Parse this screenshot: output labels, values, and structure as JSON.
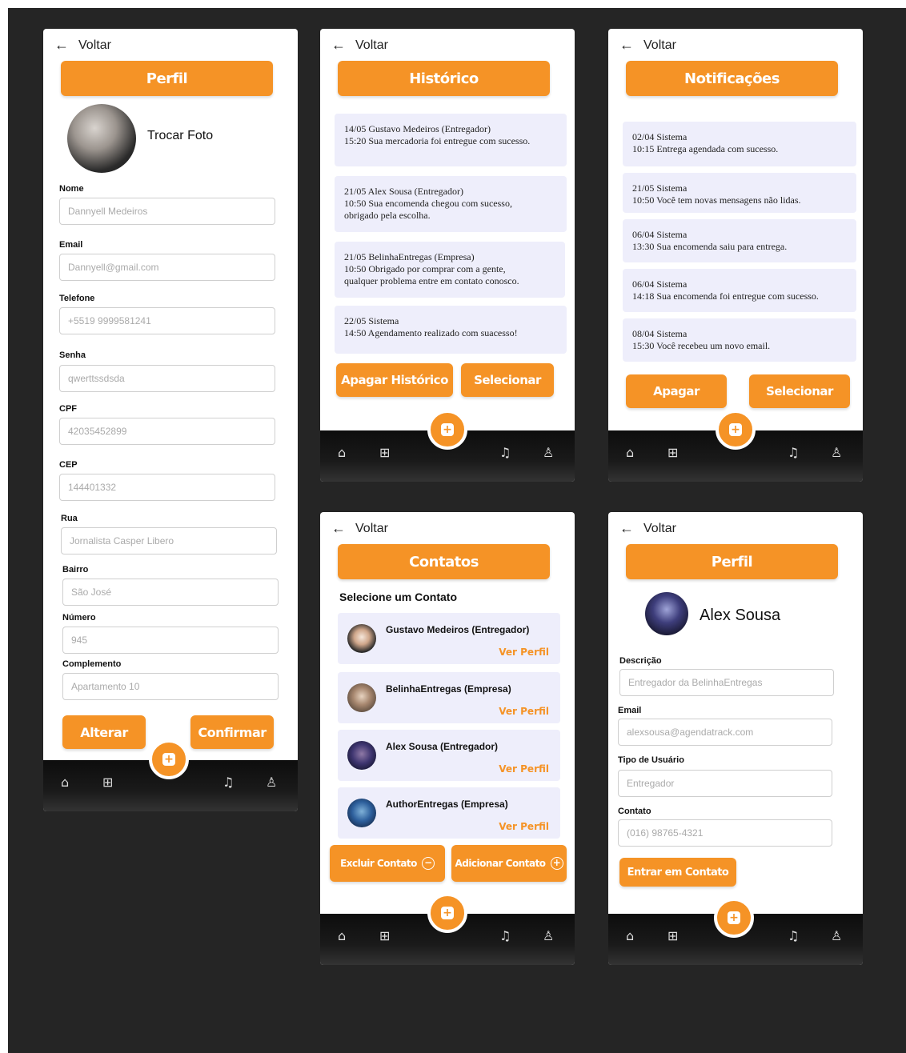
{
  "common": {
    "back_label": "Voltar",
    "nav_icons": [
      "home-icon",
      "grid-icon",
      "bell-icon",
      "user-icon"
    ]
  },
  "colors": {
    "accent": "#f59326",
    "card_bg": "#eeeefb",
    "background": "#252525"
  },
  "profile_edit": {
    "title": "Perfil",
    "change_photo": "Trocar Foto",
    "fields": [
      {
        "label": "Nome",
        "value": "Dannyell Medeiros"
      },
      {
        "label": "Email",
        "value": "Dannyell@gmail.com"
      },
      {
        "label": "Telefone",
        "value": "+5519 9999581241"
      },
      {
        "label": "Senha",
        "value": "qwerttssdsda"
      },
      {
        "label": "CPF",
        "value": "42035452899"
      },
      {
        "label": "CEP",
        "value": "144401332"
      },
      {
        "label": "Rua",
        "value": "Jornalista Casper Libero"
      },
      {
        "label": "Bairro",
        "value": "São José"
      },
      {
        "label": "Número",
        "value": "945"
      },
      {
        "label": "Complemento",
        "value": "Apartamento 10"
      }
    ],
    "alter_label": "Alterar",
    "confirm_label": "Confirmar"
  },
  "history": {
    "title": "Histórico",
    "items": [
      {
        "line1": "14/05  Gustavo Medeiros (Entregador)",
        "line2": "15:20   Sua mercadoria foi entregue com sucesso."
      },
      {
        "line1": "21/05  Alex Sousa (Entregador)",
        "line2": "10:50   Sua encomenda chegou com sucesso,",
        "line3": "obrigado pela escolha."
      },
      {
        "line1": "21/05  BelinhaEntregas (Empresa)",
        "line2": "10:50   Obrigado por comprar com a gente,",
        "line3": "qualquer problema entre em contato conosco."
      },
      {
        "line1": "22/05  Sistema",
        "line2": "14:50   Agendamento realizado com suacesso!"
      }
    ],
    "clear_label": "Apagar Histórico",
    "select_label": "Selecionar"
  },
  "notifications": {
    "title": "Notificações",
    "items": [
      {
        "line1": "02/04  Sistema",
        "line2": "10:15   Entrega agendada com sucesso."
      },
      {
        "line1": "21/05  Sistema",
        "line2": "10:50   Você tem novas mensagens não lidas."
      },
      {
        "line1": "06/04  Sistema",
        "line2": "13:30   Sua encomenda saiu para entrega."
      },
      {
        "line1": "06/04  Sistema",
        "line2": "14:18   Sua encomenda foi entregue com sucesso."
      },
      {
        "line1": "08/04  Sistema",
        "line2": "15:30   Você recebeu um novo email."
      }
    ],
    "delete_label": "Apagar",
    "select_label": "Selecionar"
  },
  "contacts": {
    "title": "Contatos",
    "subtitle": "Selecione um Contato",
    "items": [
      {
        "name": "Gustavo Medeiros (Entregador)",
        "link": "Ver Perfil"
      },
      {
        "name": "BelinhaEntregas (Empresa)",
        "link": "Ver Perfil"
      },
      {
        "name": "Alex Sousa (Entregador)",
        "link": "Ver Perfil"
      },
      {
        "name": "AuthorEntregas (Empresa)",
        "link": "Ver Perfil"
      }
    ],
    "remove_label": "Excluir Contato",
    "add_label": "Adicionar Contato"
  },
  "profile_view": {
    "title": "Perfil",
    "name": "Alex Sousa",
    "fields": [
      {
        "label": "Descrição",
        "value": "Entregador da BelinhaEntregas"
      },
      {
        "label": "Email",
        "value": "alexsousa@agendatrack.com"
      },
      {
        "label": "Tipo de Usuário",
        "value": "Entregador"
      },
      {
        "label": "Contato",
        "value": "(016) 98765-4321"
      }
    ],
    "contact_button": "Entrar em Contato"
  }
}
